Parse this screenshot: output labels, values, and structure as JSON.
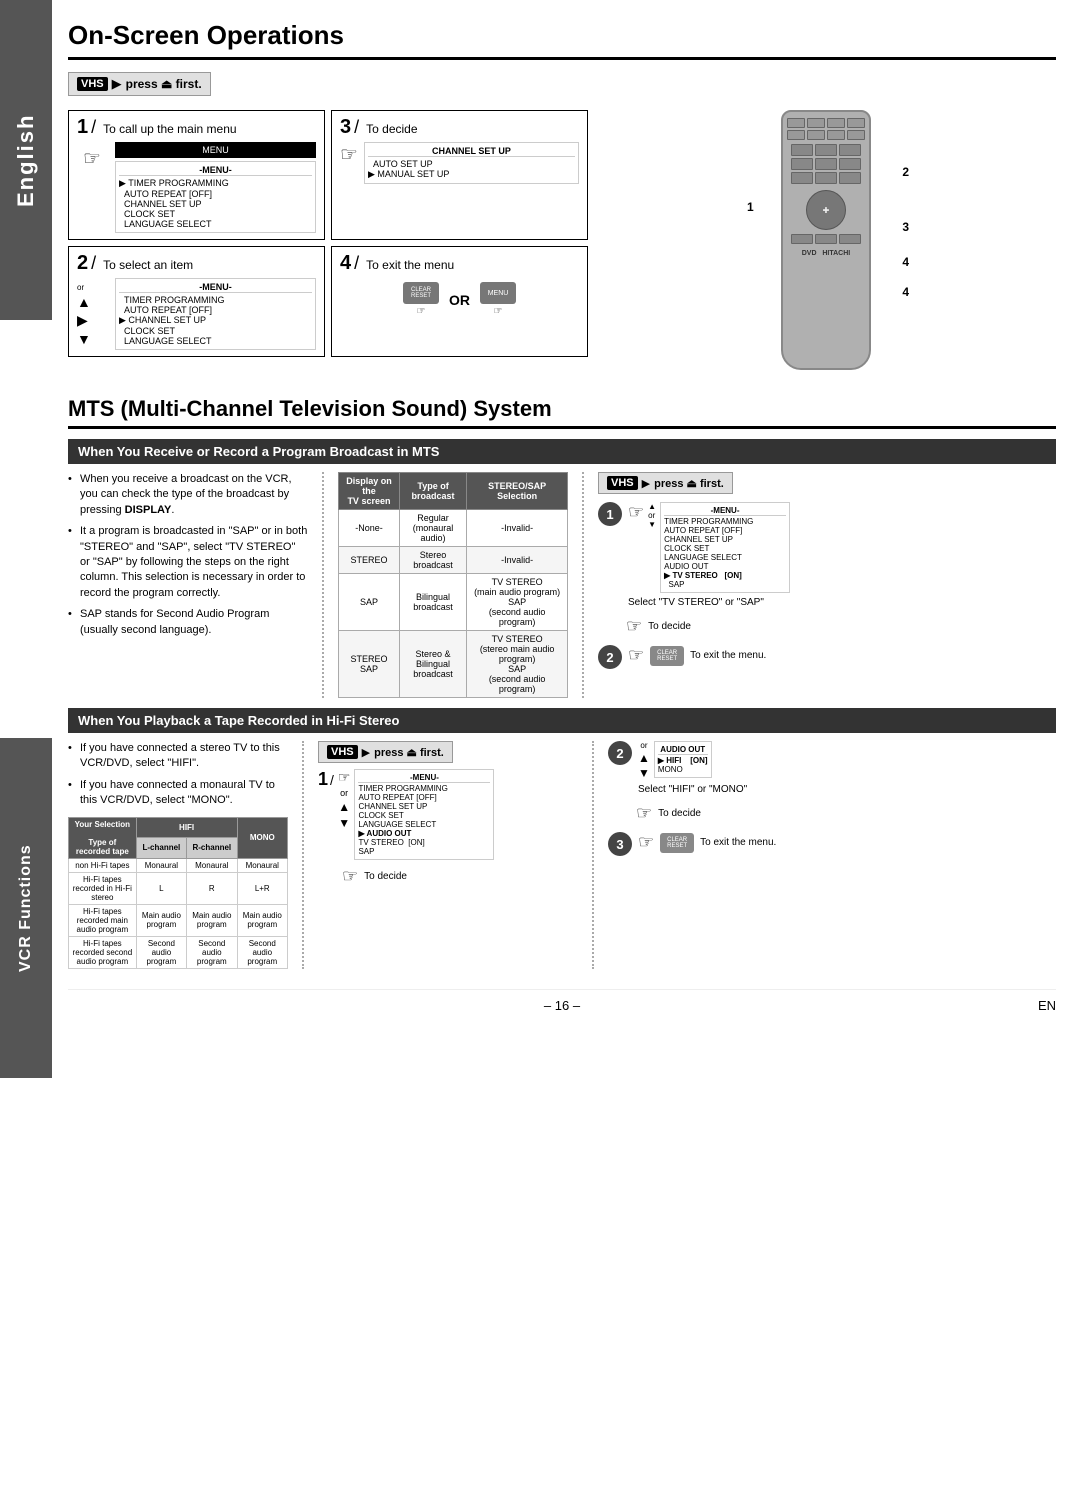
{
  "page": {
    "left_tab_english": "English",
    "left_tab_vcr": "VCR Functions",
    "page_number": "– 16 –",
    "page_en": "EN"
  },
  "on_screen": {
    "title": "On-Screen Operations",
    "vhs_press_first": "press",
    "vhs_label": "VHS",
    "first_label": "first.",
    "steps": [
      {
        "number": "1",
        "label": "To call up the main menu",
        "menu_title": "-MENU-",
        "menu_items": [
          "TIMER PROGRAMMING",
          "AUTO REPEAT [OFF]",
          "CHANNEL SET UP",
          "CLOCK SET",
          "LANGUAGE SELECT"
        ]
      },
      {
        "number": "3",
        "label": "To decide",
        "menu_title": "CHANNEL SET UP",
        "menu_items": [
          "AUTO SET UP",
          "MANUAL SET UP"
        ]
      },
      {
        "number": "2",
        "label": "To select an item",
        "menu_title": "-MENU-",
        "menu_items": [
          "TIMER PROGRAMMING",
          "AUTO REPEAT [OFF]",
          "CHANNEL SET UP",
          "CLOCK SET",
          "LANGUAGE SELECT"
        ]
      },
      {
        "number": "4",
        "label": "To exit the menu",
        "or_text": "OR"
      }
    ]
  },
  "mts": {
    "title": "MTS (Multi-Channel Television Sound) System",
    "subsection1_header": "When You Receive or Record a Program Broadcast in MTS",
    "bullet_points": [
      "When you receive a broadcast on the VCR, you can check the type of the broadcast by pressing DISPLAY.",
      "It a program is broadcasted in \"SAP\" or in both \"STEREO\" and \"SAP\", select \"TV STEREO\" or \"SAP\" by following the steps on the right column. This selection is necessary in order to record the program correctly.",
      "SAP stands for Second Audio Program (usually second language)."
    ],
    "display_bold": "DISPLAY",
    "table": {
      "headers": [
        "Display on the TV screen",
        "Type of broadcast",
        "STEREO/SAP Selection"
      ],
      "rows": [
        [
          "-None-",
          "Regular (monaural audio)",
          "-Invalid-"
        ],
        [
          "STEREO",
          "Stereo broadcast",
          "-Invalid-"
        ],
        [
          "SAP",
          "Bilingual broadcast",
          "TV STEREO (main audio program)\nSAP (second audio program)"
        ],
        [
          "STEREO SAP",
          "Stereo & Bilingual broadcast",
          "TV STEREO (stereo main audio program)\nSAP (second audio program)"
        ]
      ]
    },
    "vhs_press_first": "press",
    "steps_right": [
      {
        "number": "1",
        "instruction_title": "-MENU-",
        "instruction_items": [
          "TIMER PROGRAMMING",
          "AUTO REPEAT [OFF]",
          "CHANNEL SET UP",
          "CLOCK SET",
          "LANGUAGE SELECT",
          "AUDIO OUT",
          "TV STEREO    [ON]",
          "SAP"
        ],
        "selected_item": "TV STEREO    [ON]",
        "desc": "Select \"TV STEREO\" or \"SAP\""
      },
      {
        "number": "1b",
        "desc": "To decide"
      },
      {
        "number": "2",
        "desc": "To exit the menu."
      }
    ]
  },
  "hifi": {
    "subsection2_header": "When You Playback a Tape Recorded in Hi-Fi Stereo",
    "bullet_points": [
      "If you have connected a stereo TV to this VCR/DVD, select \"HIFI\".",
      "If you have connected a monaural TV to this VCR/DVD, select \"MONO\"."
    ],
    "vhs_press_first": "press",
    "table": {
      "your_selection_label": "Your Selection",
      "hifi_label": "HIFI",
      "mono_label": "MONO",
      "l_channel": "L-channel",
      "r_channel": "R-channel",
      "type_label": "Type of recorded tape",
      "rows": [
        {
          "type": "non Hi-Fi tapes",
          "l": "Monaural",
          "r": "Monaural",
          "mono": "Monaural"
        },
        {
          "type": "Hi-Fi tapes recorded in Hi-Fi stereo",
          "l": "L",
          "r": "R",
          "mono": "L+R"
        },
        {
          "type": "Hi-Fi tapes recorded main audio program",
          "l": "Main audio program",
          "r": "Main audio program",
          "mono": "Main audio program"
        },
        {
          "type": "Hi-Fi tapes recorded second audio program",
          "l": "Second audio program",
          "r": "Second audio program",
          "mono": "Second audio program"
        }
      ]
    },
    "steps_center": [
      {
        "number": "1",
        "instruction_title": "-MENU-",
        "instruction_items": [
          "TIMER PROGRAMMING",
          "AUTO REPEAT [OFF]",
          "CHANNEL SET UP",
          "CLOCK SET",
          "LANGUAGE SELECT",
          "AUDIO OUT",
          "TV STEREO    [ON]",
          "SAP"
        ],
        "selected": "AUDIO OUT"
      }
    ],
    "steps_right": [
      {
        "number": "2",
        "instruction_title": "AUDIO OUT",
        "instruction_items": [
          "HIFI    [ON]",
          "MONO"
        ],
        "selected": "HIFI    [ON]",
        "desc": "Select \"HIFI\" or \"MONO\""
      },
      {
        "number": "2b",
        "desc": "To decide"
      },
      {
        "number": "3",
        "desc": "To exit the menu."
      }
    ]
  }
}
